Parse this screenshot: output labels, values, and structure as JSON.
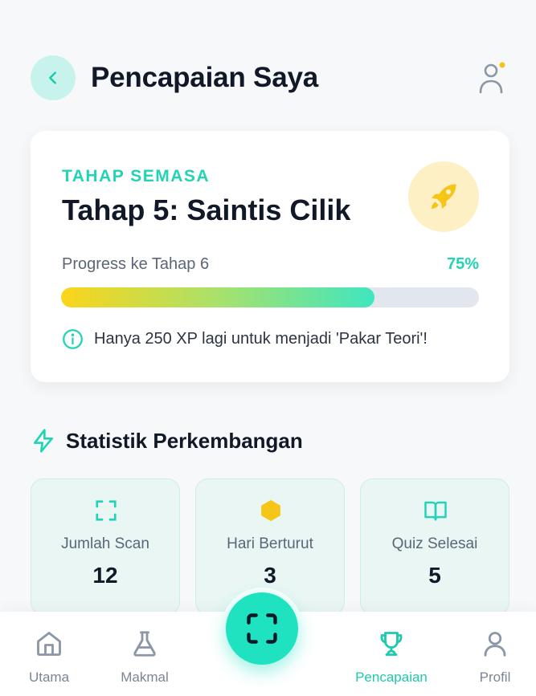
{
  "header": {
    "title": "Pencapaian Saya",
    "back_icon": "chevron-left-icon",
    "profile_icon": "user-icon",
    "notification_dot_color": "#f5c518"
  },
  "stage_card": {
    "eyebrow": "TAHAP SEMASA",
    "title": "Tahap 5: Saintis Cilik",
    "badge_icon": "rocket-icon",
    "progress_label": "Progress ke Tahap 6",
    "progress_percent_text": "75%",
    "progress_value": 0.75,
    "info_text": "Hanya 250 XP lagi untuk menjadi 'Pakar Teori'!"
  },
  "stats_section": {
    "title": "Statistik Perkembangan",
    "icon": "lightning-icon",
    "items": [
      {
        "label": "Jumlah Scan",
        "value": "12",
        "icon": "scan-icon"
      },
      {
        "label": "Hari Berturut",
        "value": "3",
        "icon": "hexagon-icon"
      },
      {
        "label": "Quiz Selesai",
        "value": "5",
        "icon": "book-icon"
      }
    ]
  },
  "nav": {
    "items": [
      {
        "label": "Utama",
        "icon": "home-icon"
      },
      {
        "label": "Makmal",
        "icon": "flask-icon"
      },
      {
        "label": "Pencapaian",
        "icon": "trophy-icon"
      },
      {
        "label": "Profil",
        "icon": "user-icon"
      }
    ],
    "active": "Pencapaian",
    "fab_icon": "scan-icon"
  },
  "colors": {
    "accent": "#22d3b4",
    "fab": "#1fe3c0",
    "badge_bg": "#fdf0c4",
    "rocket": "#f5c518"
  }
}
